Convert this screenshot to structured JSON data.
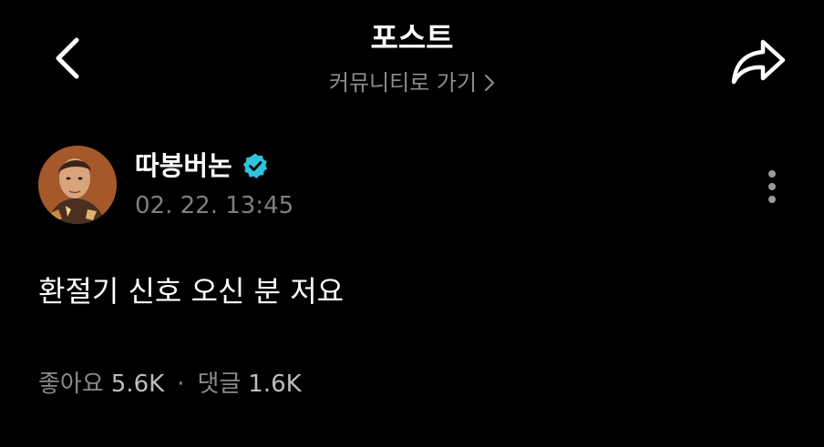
{
  "header": {
    "title": "포스트",
    "community_link": "커뮤니티로 가기",
    "back_icon": "chevron-left-icon",
    "share_icon": "share-arrow-icon",
    "link_icon": "chevron-right-icon"
  },
  "post": {
    "author": {
      "name": "따봉버논",
      "verified": true,
      "verified_color": "#2fc3dc"
    },
    "timestamp": "02. 22. 13:45",
    "body": "환절기 신호 오신 분 저요",
    "stats": {
      "likes_label": "좋아요",
      "likes_value": "5.6K",
      "separator": "·",
      "comments_label": "댓글",
      "comments_value": "1.6K"
    }
  },
  "colors": {
    "background": "#000000",
    "text_primary": "#ffffff",
    "text_secondary": "#8c8c8c"
  }
}
